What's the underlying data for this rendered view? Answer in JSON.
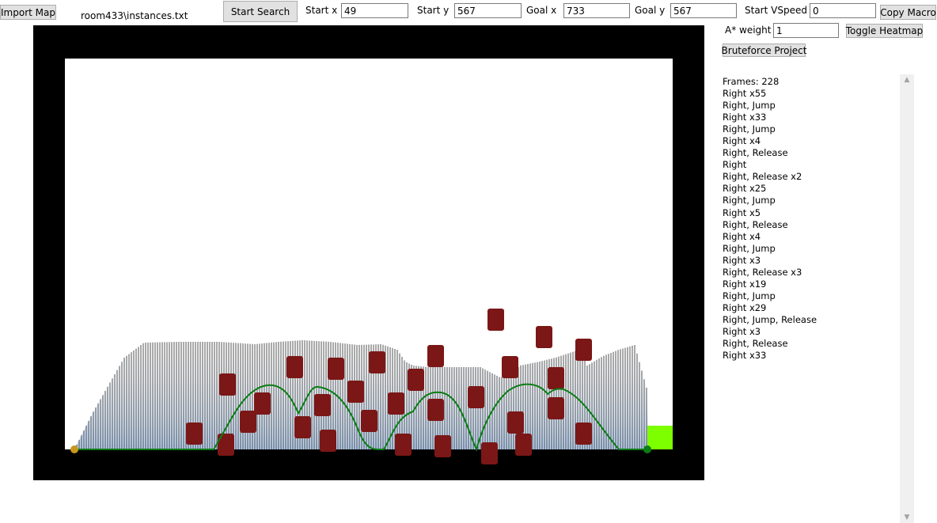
{
  "toolbar": {
    "import_label": "Import Map",
    "file_path": "room433\\instances.txt",
    "start_search_label": "Start Search",
    "start_x_label": "Start x",
    "start_x_value": "49",
    "start_y_label": "Start y",
    "start_y_value": "567",
    "goal_x_label": "Goal x",
    "goal_x_value": "733",
    "goal_y_label": "Goal y",
    "goal_y_value": "567",
    "start_vspeed_label": "Start VSpeed",
    "start_vspeed_value": "0",
    "copy_macro_label": "Copy Macro",
    "astar_weight_label": "A* weight",
    "astar_weight_value": "1",
    "toggle_heatmap_label": "Toggle Heatmap",
    "bruteforce_label": "Bruteforce Project"
  },
  "macro": [
    "Frames: 228",
    "Right x55",
    "Right, Jump",
    "Right x33",
    "Right, Jump",
    "Right x4",
    "Right, Release",
    "Right",
    "Right, Release x2",
    "Right x25",
    "Right, Jump",
    "Right x5",
    "Right, Release",
    "Right x4",
    "Right, Jump",
    "Right x3",
    "Right, Release x3",
    "Right x19",
    "Right, Jump",
    "Right x29",
    "Right, Jump, Release",
    "Right x3",
    "Right, Release",
    "Right x33"
  ],
  "colors": {
    "wall": "#000000",
    "floor_area": "#ffffff",
    "obstacle": "#7b1716",
    "path": "#0a7d14",
    "goal_zone": "#7dff00",
    "start_marker": "#c8961e",
    "goal_marker": "#0a7d14",
    "reach_lines": "#1a1a1a",
    "heat": "#a9c7ec"
  },
  "icons": {
    "scroll_up": "chevron-up-icon",
    "scroll_down": "chevron-down-icon"
  }
}
